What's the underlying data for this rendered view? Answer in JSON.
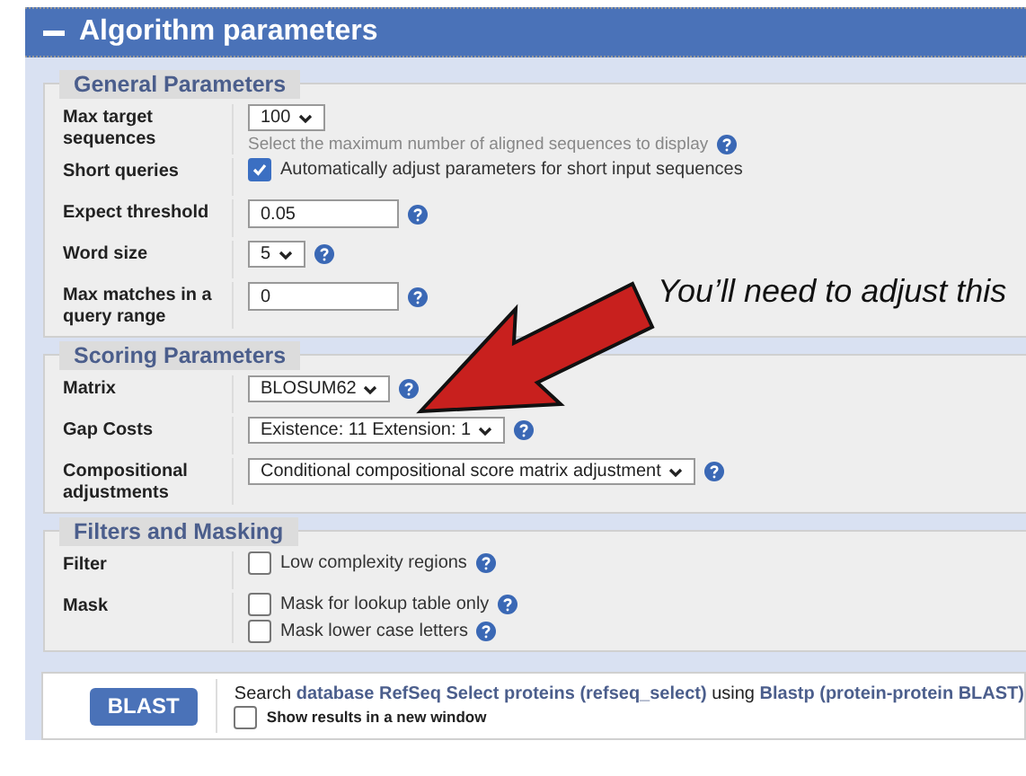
{
  "section": {
    "title": "Algorithm parameters",
    "expanded": true
  },
  "panels": [
    {
      "title": "General Parameters",
      "rows": [
        {
          "label": "Max target sequences",
          "controls": [
            {
              "kind": "select",
              "value": "100",
              "help": false
            },
            {
              "kind": "hint",
              "text": "Select the maximum number of aligned sequences to display",
              "help": true
            }
          ]
        },
        {
          "label": "Short queries",
          "controls": [
            {
              "kind": "checkbox",
              "text": "Automatically adjust parameters for short input sequences",
              "checked": true,
              "help": false
            }
          ]
        },
        {
          "label": "Expect threshold",
          "controls": [
            {
              "kind": "input",
              "value": "0.05",
              "help": true
            }
          ]
        },
        {
          "label": "Word size",
          "controls": [
            {
              "kind": "select",
              "value": "5",
              "help": true
            }
          ]
        },
        {
          "label": "Max matches in a query range",
          "controls": [
            {
              "kind": "input",
              "value": "0",
              "help": true
            }
          ]
        }
      ]
    },
    {
      "title": "Scoring Parameters",
      "rows": [
        {
          "label": "Matrix",
          "controls": [
            {
              "kind": "select",
              "value": "BLOSUM62",
              "help": true
            }
          ]
        },
        {
          "label": "Gap Costs",
          "controls": [
            {
              "kind": "select",
              "value": "Existence: 11 Extension: 1",
              "help": true
            }
          ]
        },
        {
          "label": "Compositional adjustments",
          "controls": [
            {
              "kind": "select",
              "value": "Conditional compositional score matrix adjustment",
              "help": true
            }
          ]
        }
      ]
    },
    {
      "title": "Filters and Masking",
      "rows": [
        {
          "label": "Filter",
          "controls": [
            {
              "kind": "checkbox",
              "text": "Low complexity regions",
              "checked": false,
              "help": true
            }
          ]
        },
        {
          "label": "Mask",
          "controls": [
            {
              "kind": "checkbox",
              "text": "Mask for lookup table only",
              "checked": false,
              "help": true
            },
            {
              "kind": "checkbox",
              "text": "Mask lower case letters",
              "checked": false,
              "help": true
            }
          ]
        }
      ]
    }
  ],
  "annotation": {
    "text": "You’ll need to adjust this"
  },
  "submit": {
    "button": "BLAST",
    "sentence": [
      {
        "kind": "text",
        "text": "Search "
      },
      {
        "kind": "link",
        "text": "database RefSeq Select proteins (refseq_select)"
      },
      {
        "kind": "text",
        "text": " using "
      },
      {
        "kind": "link",
        "text": "Blastp (protein-protein BLAST)"
      }
    ],
    "new_window": {
      "label": "Show results in a new window",
      "checked": false
    }
  }
}
